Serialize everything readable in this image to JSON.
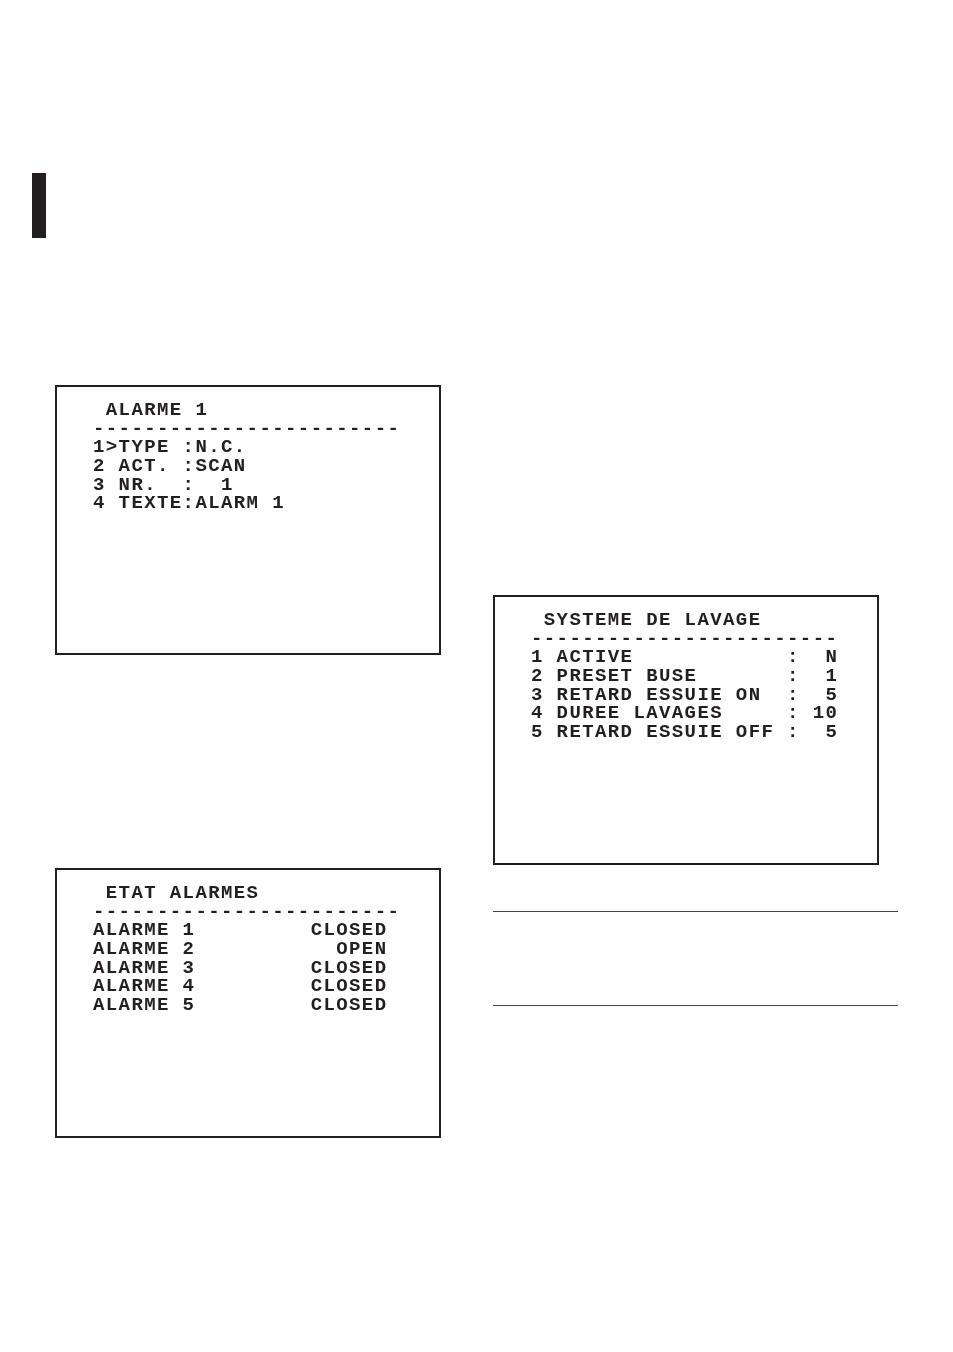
{
  "left_column": {
    "screens": [
      {
        "title": "ALARME 1",
        "separator": "------------------------",
        "lines": [
          "1>TYPE :N.C.",
          "2 ACT. :SCAN",
          "3 NR.  :  1",
          "4 TEXTE:ALARM 1"
        ]
      },
      {
        "title": "ETAT ALARMES",
        "separator": "------------------------",
        "lines": [
          "ALARME 1         CLOSED",
          "ALARME 2           OPEN",
          "ALARME 3         CLOSED",
          "ALARME 4         CLOSED",
          "ALARME 5         CLOSED"
        ]
      }
    ]
  },
  "right_column": {
    "screens": [
      {
        "title": "SYSTEME DE LAVAGE",
        "separator": "------------------------",
        "lines": [
          "1 ACTIVE            :  N",
          "2 PRESET BUSE       :  1",
          "3 RETARD ESSUIE ON  :  5",
          "4 DUREE LAVAGES     : 10",
          "5 RETARD ESSUIE OFF :  5"
        ]
      }
    ]
  }
}
